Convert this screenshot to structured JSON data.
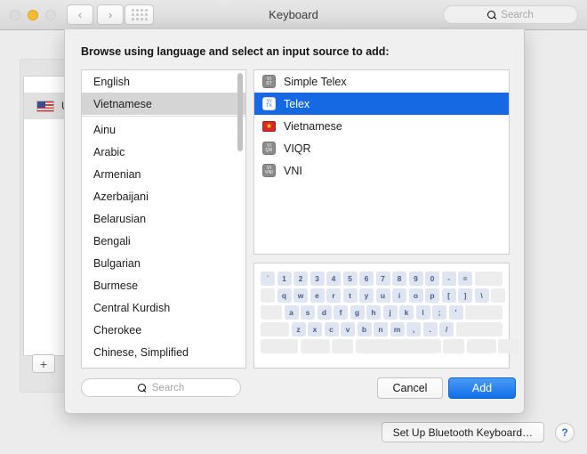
{
  "window": {
    "title": "Keyboard",
    "traffic_lights": [
      "close",
      "minimize",
      "zoom"
    ],
    "nav_back": "‹",
    "nav_forward": "›",
    "grid_button": "show-all-icon",
    "search_placeholder": "Search"
  },
  "background": {
    "plus_label": "+",
    "input_source_label": "U",
    "flag_icon": "us-flag-icon"
  },
  "bottom_bar": {
    "bluetooth_button": "Set Up Bluetooth Keyboard…",
    "help_button": "?"
  },
  "sheet": {
    "heading": "Browse using language and select an input source to add:",
    "languages": [
      {
        "label": "English",
        "selected": false,
        "separator_after": false
      },
      {
        "label": "Vietnamese",
        "selected": true,
        "separator_after": true
      },
      {
        "label": "Ainu",
        "selected": false,
        "separator_after": false
      },
      {
        "label": "Arabic",
        "selected": false,
        "separator_after": false
      },
      {
        "label": "Armenian",
        "selected": false,
        "separator_after": false
      },
      {
        "label": "Azerbaijani",
        "selected": false,
        "separator_after": false
      },
      {
        "label": "Belarusian",
        "selected": false,
        "separator_after": false
      },
      {
        "label": "Bengali",
        "selected": false,
        "separator_after": false
      },
      {
        "label": "Bulgarian",
        "selected": false,
        "separator_after": false
      },
      {
        "label": "Burmese",
        "selected": false,
        "separator_after": false
      },
      {
        "label": "Central Kurdish",
        "selected": false,
        "separator_after": false
      },
      {
        "label": "Cherokee",
        "selected": false,
        "separator_after": false
      },
      {
        "label": "Chinese, Simplified",
        "selected": false,
        "separator_after": false
      }
    ],
    "input_sources": [
      {
        "label": "Simple Telex",
        "icon": "badge",
        "badge_top": "VI",
        "badge_bottom": "ST",
        "selected": false
      },
      {
        "label": "Telex",
        "icon": "badge",
        "badge_top": "VI",
        "badge_bottom": "TX",
        "selected": true
      },
      {
        "label": "Vietnamese",
        "icon": "vn-flag",
        "badge_top": "",
        "badge_bottom": "",
        "selected": false
      },
      {
        "label": "VIQR",
        "icon": "badge",
        "badge_top": "VI",
        "badge_bottom": "QR",
        "selected": false
      },
      {
        "label": "VNI",
        "icon": "badge",
        "badge_top": "VI",
        "badge_bottom": "VNI",
        "selected": false
      }
    ],
    "keyboard_preview": {
      "rows": [
        [
          "`",
          "1",
          "2",
          "3",
          "4",
          "5",
          "6",
          "7",
          "8",
          "9",
          "0",
          "-",
          "="
        ],
        [
          "q",
          "w",
          "e",
          "r",
          "t",
          "y",
          "u",
          "i",
          "o",
          "p",
          "[",
          "]",
          "\\"
        ],
        [
          "a",
          "s",
          "d",
          "f",
          "g",
          "h",
          "j",
          "k",
          "l",
          ";",
          "'"
        ],
        [
          "z",
          "x",
          "c",
          "v",
          "b",
          "n",
          "m",
          ",",
          ".",
          "/"
        ]
      ]
    },
    "search_placeholder": "Search",
    "cancel_label": "Cancel",
    "add_label": "Add"
  },
  "colors": {
    "accent": "#1668e3",
    "add_button": "#1170e8",
    "selection_inactive": "#d5d5d5",
    "key_face": "#dfe6f2",
    "key_text": "#4a5d8f",
    "flag_red": "#d62828",
    "flag_star": "#ffdd00"
  }
}
